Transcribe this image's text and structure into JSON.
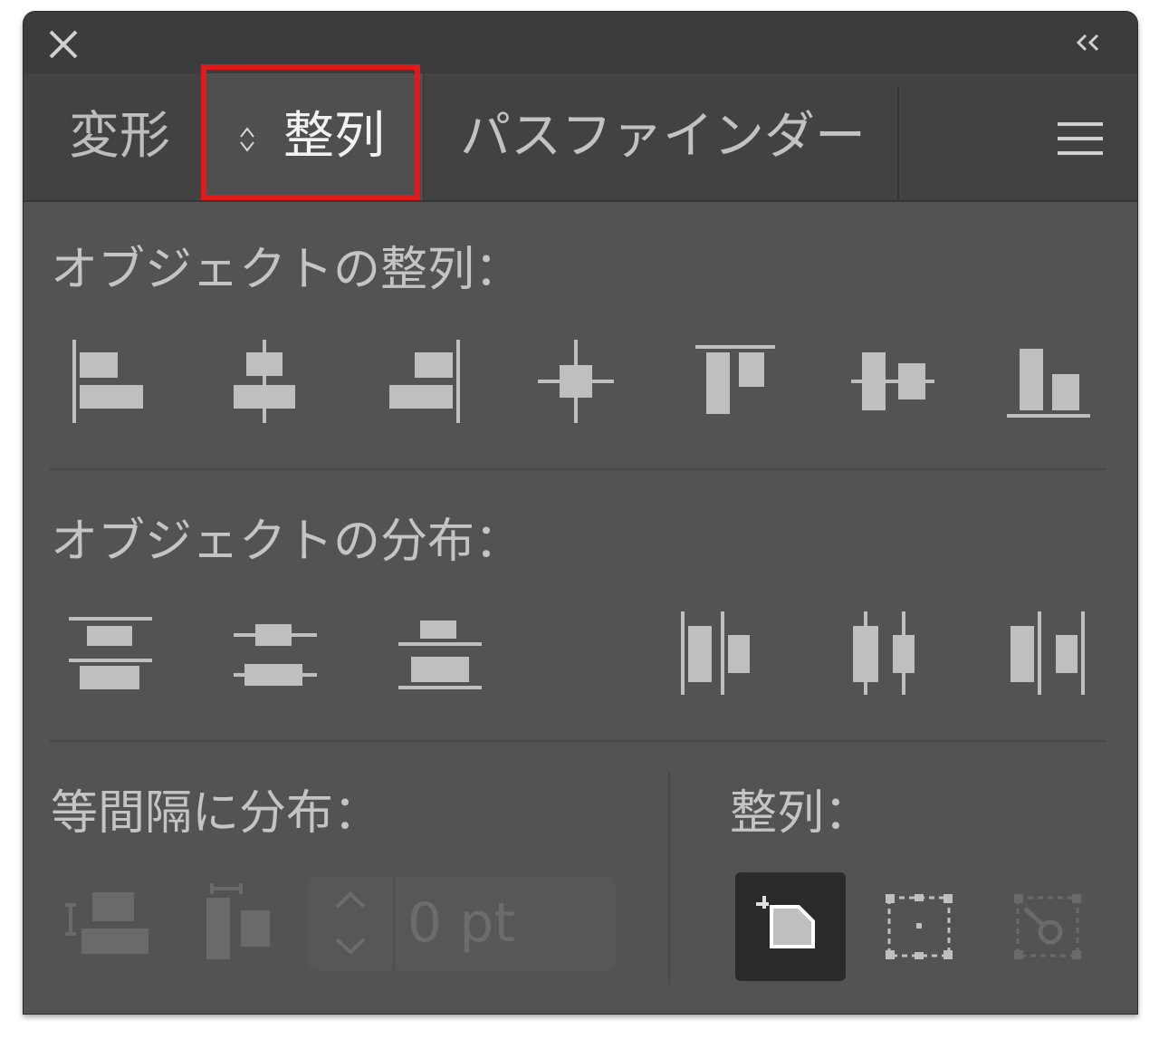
{
  "panel": {
    "tabs": [
      {
        "label": "変形",
        "active": false
      },
      {
        "label": "整列",
        "active": true
      },
      {
        "label": "パスファインダー",
        "active": false
      }
    ]
  },
  "sections": {
    "align_objects": {
      "label": "オブジェクトの整列：",
      "icons": [
        "align-left-icon",
        "align-horizontal-center-icon",
        "align-right-icon",
        "align-center-icon",
        "align-top-icon",
        "align-vertical-center-icon",
        "align-bottom-icon"
      ]
    },
    "distribute_objects": {
      "label": "オブジェクトの分布：",
      "icons": [
        "distribute-top-icon",
        "distribute-vertical-center-icon",
        "distribute-bottom-icon",
        "distribute-left-icon",
        "distribute-horizontal-center-icon",
        "distribute-right-icon"
      ]
    },
    "distribute_spacing": {
      "label": "等間隔に分布：",
      "spacing_value": "0 pt",
      "enabled": false
    },
    "align_to": {
      "label": "整列：",
      "selected": "align-to-selection"
    }
  },
  "colors": {
    "panel_bg": "#535353",
    "highlight": "#e0191b",
    "icon": "#bfbfbf",
    "disabled_icon": "#6a6a6a"
  }
}
